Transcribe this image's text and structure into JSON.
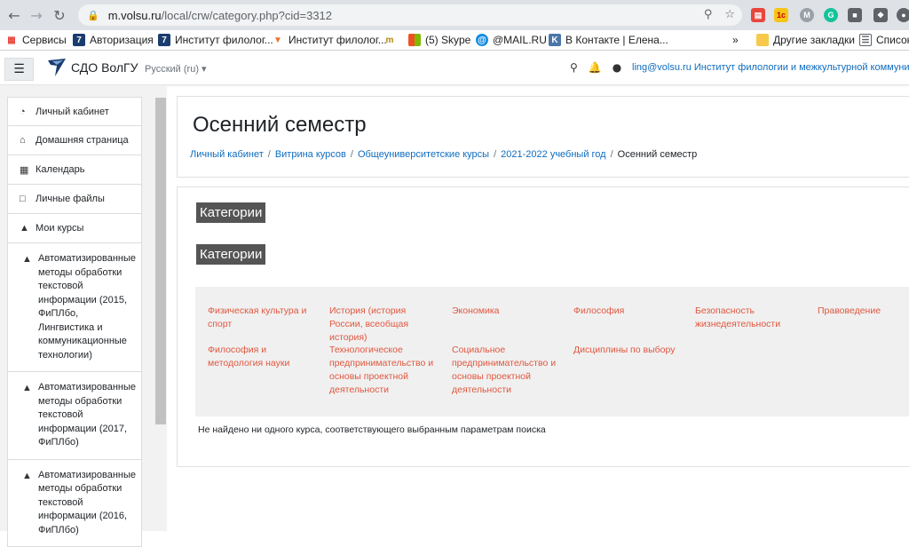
{
  "browser": {
    "url_host": "m.volsu.ru",
    "url_path": "/local/crw/category.php?cid=3312"
  },
  "bookmarks": {
    "items": [
      {
        "label": "Сервисы",
        "icon": "apps-grid-icon"
      },
      {
        "label": "Авторизация",
        "icon": "volsu-icon"
      },
      {
        "label": "Институт филолог...",
        "icon": "volsu-icon"
      },
      {
        "label": "Институт филолог...",
        "icon": "volsu-icon"
      },
      {
        "label": "",
        "icon": "tm-icon"
      },
      {
        "label": "(5) Skype",
        "icon": "microsoft-icon"
      },
      {
        "label": "@MAIL.RU",
        "icon": "mailru-icon"
      },
      {
        "label": "В Контакте | Елена...",
        "icon": "vk-icon"
      }
    ],
    "more": "»",
    "other": "Другие закладки",
    "reading_list": "Список"
  },
  "header": {
    "site_name": "СДО ВолГУ",
    "language": "Русский (ru)",
    "user": "ling@volsu.ru Институт филологии и межкультурной коммуникации"
  },
  "drawer": {
    "items": [
      {
        "label": "Личный кабинет",
        "icon": "dashboard-icon"
      },
      {
        "label": "Домашняя страница",
        "icon": "home-icon"
      },
      {
        "label": "Календарь",
        "icon": "calendar-icon"
      },
      {
        "label": "Личные файлы",
        "icon": "file-icon"
      },
      {
        "label": "Мои курсы",
        "icon": "graduation-cap-icon"
      }
    ],
    "courses": [
      {
        "label": "Автоматизированные методы обработки текстовой информации (2015, ФиПЛбо, Лингвистика и коммуникационные технологии)"
      },
      {
        "label": "Автоматизированные методы обработки текстовой информации (2017, ФиПЛбо)"
      },
      {
        "label": "Автоматизированные методы обработки текстовой информации (2016, ФиПЛбо)"
      }
    ]
  },
  "page": {
    "title": "Осенний семестр",
    "breadcrumb": [
      "Личный кабинет",
      "Витрина курсов",
      "Общеуниверситетские курсы",
      "2021-2022 учебный год"
    ],
    "breadcrumb_current": "Осенний семестр"
  },
  "categories": {
    "heading1": "Категории",
    "heading2": "Категории",
    "items": [
      "Физическая культура и спорт",
      "История (история России, всеобщая история)",
      "Экономика",
      "Философия",
      "Безопасность жизнедеятельности",
      "Правоведение",
      "Философия и методология науки",
      "Технологическое предпринимательство и основы проектной деятельности",
      "Социальное предпринимательство и основы проектной деятельности",
      "Дисциплины по выбору"
    ],
    "empty_message": "Не найдено ни одного курса, соответствующего выбранным параметрам поиска"
  },
  "colors": {
    "link": "#0f6cbf",
    "category_link": "#e0573f",
    "category_heading_bg": "#555555"
  }
}
